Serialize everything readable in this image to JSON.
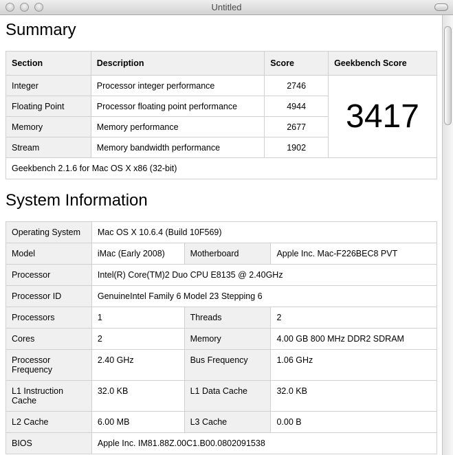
{
  "window": {
    "title": "Untitled"
  },
  "summary": {
    "heading": "Summary",
    "columns": [
      "Section",
      "Description",
      "Score",
      "Geekbench Score"
    ],
    "rows": [
      {
        "section": "Integer",
        "description": "Processor integer performance",
        "score": "2746"
      },
      {
        "section": "Floating Point",
        "description": "Processor floating point performance",
        "score": "4944"
      },
      {
        "section": "Memory",
        "description": "Memory performance",
        "score": "2677"
      },
      {
        "section": "Stream",
        "description": "Memory bandwidth performance",
        "score": "1902"
      }
    ],
    "geekbench_score": "3417",
    "footer": "Geekbench 2.1.6 for Mac OS X x86 (32-bit)"
  },
  "system": {
    "heading": "System Information",
    "os_label": "Operating System",
    "os": "Mac OS X 10.6.4 (Build 10F569)",
    "model_label": "Model",
    "model": "iMac (Early 2008)",
    "motherboard_label": "Motherboard",
    "motherboard": "Apple Inc. Mac-F226BEC8 PVT",
    "processor_label": "Processor",
    "processor": "Intel(R) Core(TM)2 Duo CPU E8135 @ 2.40GHz",
    "processor_id_label": "Processor ID",
    "processor_id": "GenuineIntel Family 6 Model 23 Stepping 6",
    "processors_label": "Processors",
    "processors": "1",
    "threads_label": "Threads",
    "threads": "2",
    "cores_label": "Cores",
    "cores": "2",
    "memory_label": "Memory",
    "memory": "4.00 GB  800 MHz DDR2 SDRAM",
    "proc_freq_label": "Processor Frequency",
    "proc_freq": "2.40 GHz",
    "bus_freq_label": "Bus Frequency",
    "bus_freq": "1.06 GHz",
    "l1i_label": "L1 Instruction Cache",
    "l1i": "32.0 KB",
    "l1d_label": "L1 Data Cache",
    "l1d": "32.0 KB",
    "l2_label": "L2 Cache",
    "l2": "6.00 MB",
    "l3_label": "L3 Cache",
    "l3": "0.00 B",
    "bios_label": "BIOS",
    "bios": "Apple Inc. IM81.88Z.00C1.B00.0802091538"
  }
}
